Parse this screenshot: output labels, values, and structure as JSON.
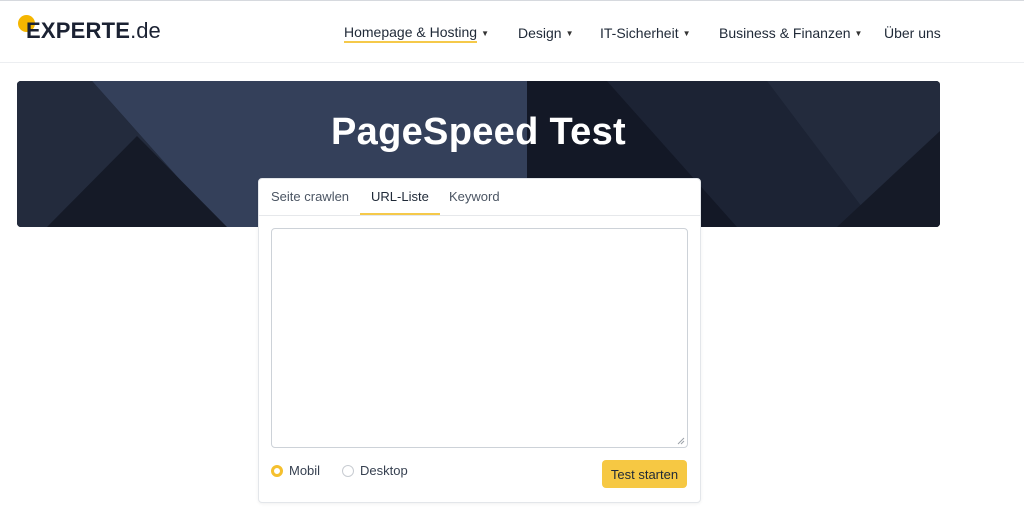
{
  "brand": {
    "name": "EXPERTE",
    "suffix": ".de",
    "accent": "#f5b600"
  },
  "nav": [
    {
      "label": "Homepage & Hosting",
      "has_dropdown": true,
      "active": true
    },
    {
      "label": "Design",
      "has_dropdown": true
    },
    {
      "label": "IT-Sicherheit",
      "has_dropdown": true
    },
    {
      "label": "Business & Finanzen",
      "has_dropdown": true
    },
    {
      "label": "Über uns",
      "has_dropdown": false
    }
  ],
  "hero": {
    "title": "PageSpeed Test",
    "background": "#1a2030"
  },
  "tool": {
    "tabs": [
      {
        "label": "Seite crawlen",
        "active": false
      },
      {
        "label": "URL-Liste",
        "active": true
      },
      {
        "label": "Keyword",
        "active": false
      }
    ],
    "url_list": {
      "value": "",
      "placeholder": ""
    },
    "device_options": [
      {
        "label": "Mobil",
        "checked": true
      },
      {
        "label": "Desktop",
        "checked": false
      }
    ],
    "submit_label": "Test starten",
    "button_color": "#f6c843"
  },
  "icons": {
    "dropdown": "caret-down-icon"
  }
}
